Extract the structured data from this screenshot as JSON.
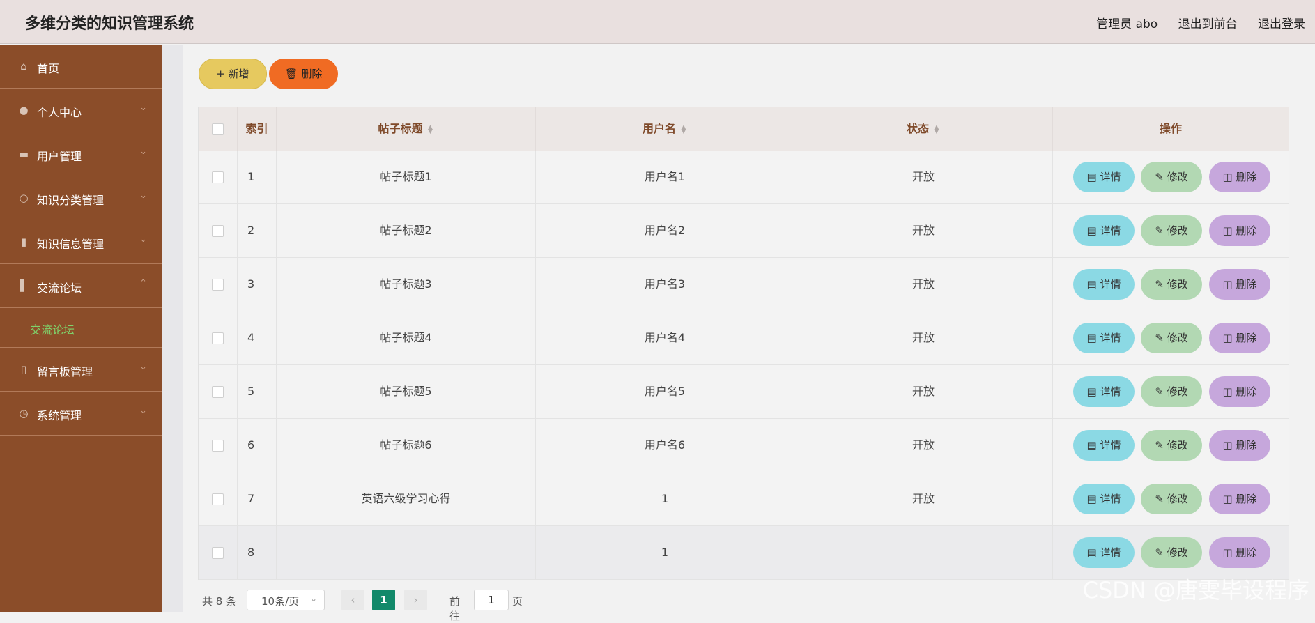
{
  "app": {
    "title": "多维分类的知识管理系统"
  },
  "header": {
    "nav": [
      "管理员 abo",
      "退出到前台",
      "退出登录"
    ]
  },
  "sidebar": {
    "items": [
      {
        "label": "首页",
        "icon": "home-icon",
        "expandable": false
      },
      {
        "label": "个人中心",
        "icon": "user-icon",
        "expandable": true
      },
      {
        "label": "用户管理",
        "icon": "monitor-icon",
        "expandable": true
      },
      {
        "label": "知识分类管理",
        "icon": "compass-icon",
        "expandable": true
      },
      {
        "label": "知识信息管理",
        "icon": "comment-icon",
        "expandable": true
      },
      {
        "label": "交流论坛",
        "icon": "bar-chart-icon",
        "expandable": true,
        "expanded": true
      },
      {
        "label": "留言板管理",
        "icon": "phone-icon",
        "expandable": true
      },
      {
        "label": "系统管理",
        "icon": "clock-icon",
        "expandable": true
      }
    ],
    "subitem": "交流论坛"
  },
  "toolbar": {
    "add_label": "新增",
    "delete_label": "删除"
  },
  "table": {
    "headers": [
      "索引",
      "帖子标题",
      "用户名",
      "状态",
      "操作"
    ],
    "rows": [
      {
        "index": "1",
        "title": "帖子标题1",
        "user": "用户名1",
        "status": "开放"
      },
      {
        "index": "2",
        "title": "帖子标题2",
        "user": "用户名2",
        "status": "开放"
      },
      {
        "index": "3",
        "title": "帖子标题3",
        "user": "用户名3",
        "status": "开放"
      },
      {
        "index": "4",
        "title": "帖子标题4",
        "user": "用户名4",
        "status": "开放"
      },
      {
        "index": "5",
        "title": "帖子标题5",
        "user": "用户名5",
        "status": "开放"
      },
      {
        "index": "6",
        "title": "帖子标题6",
        "user": "用户名6",
        "status": "开放"
      },
      {
        "index": "7",
        "title": "英语六级学习心得",
        "user": "1",
        "status": "开放"
      },
      {
        "index": "8",
        "title": "",
        "user": "1",
        "status": ""
      }
    ],
    "actions": {
      "detail": "详情",
      "edit": "修改",
      "delete": "删除"
    }
  },
  "pagination": {
    "total": "共 8 条",
    "page_size": "10条/页",
    "current_page": "1",
    "goto_label": "前往",
    "goto_value": "1",
    "page_suffix": "页"
  },
  "watermark": "CSDN @唐雯毕设程序",
  "colors": {
    "sidebar": "#8b4d29",
    "header": "#e9e0df",
    "add_button": "#e6c95f",
    "delete_button": "#f06b23",
    "detail_button": "#8bd9e4",
    "edit_button": "#b2d8b3",
    "row_delete_button": "#c6a7dc",
    "active_submenu": "#7fd36b",
    "pager_active": "#12896a"
  }
}
